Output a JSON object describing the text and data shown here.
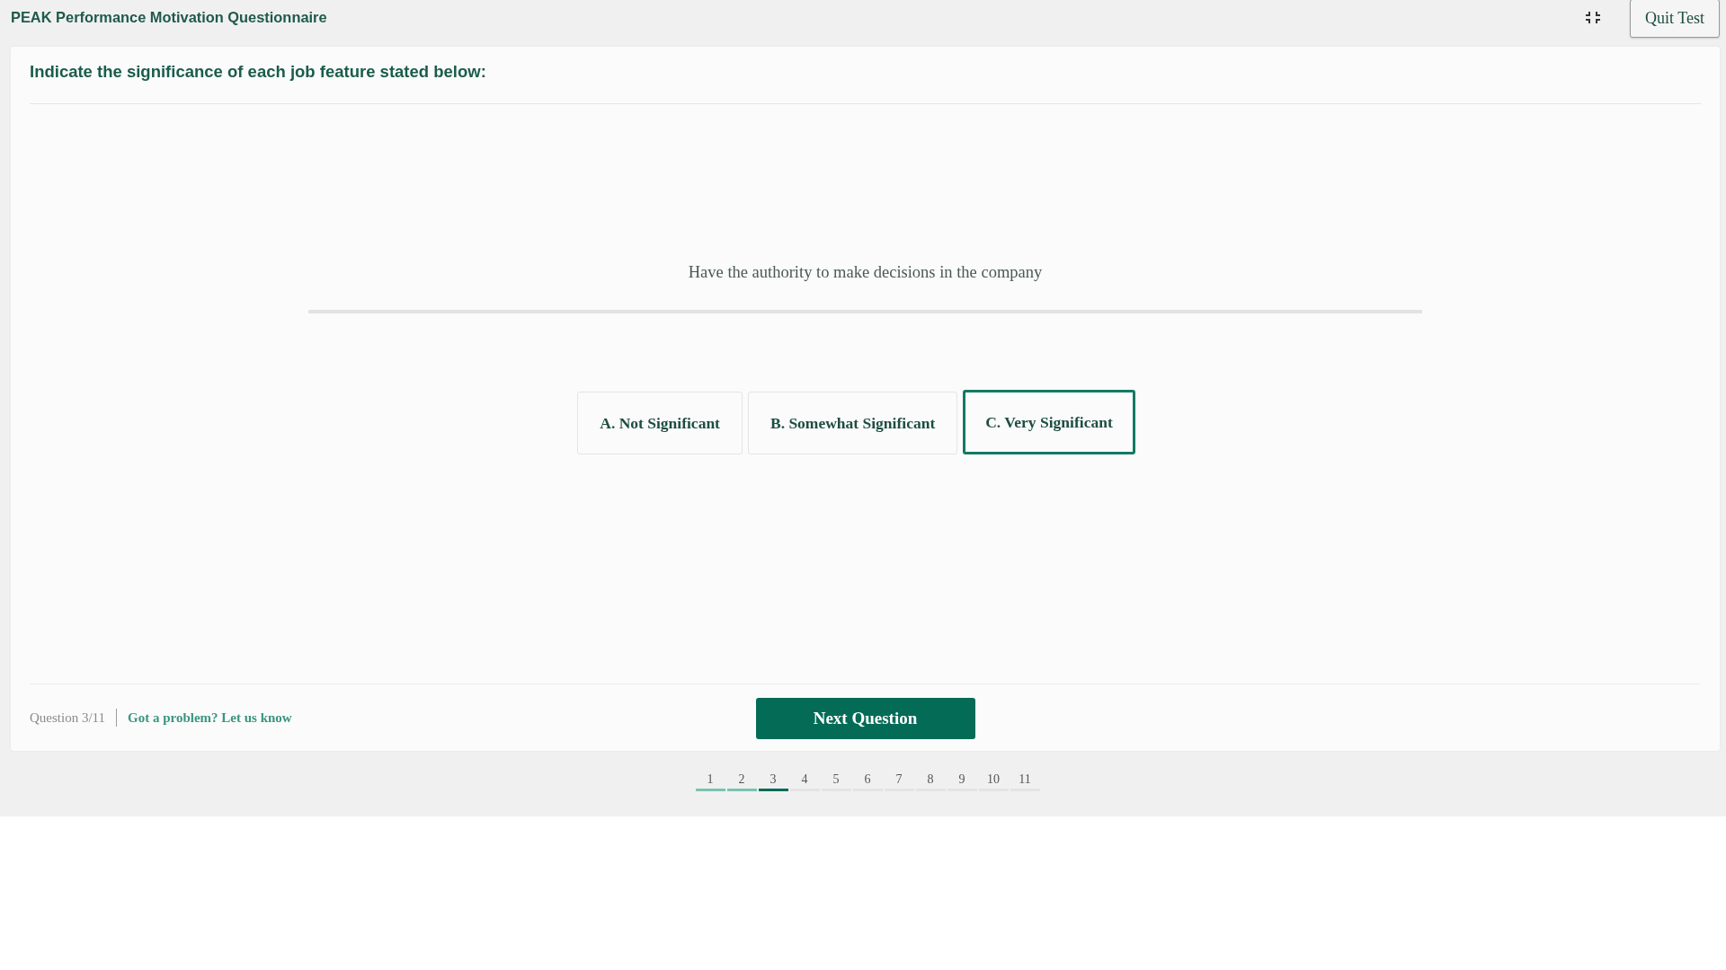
{
  "header": {
    "title": "PEAK Performance Motivation Questionnaire",
    "quit_button": "Quit Test"
  },
  "instruction": "Indicate the significance of each job feature stated below:",
  "question": "Have the authority to make decisions in the company",
  "options": [
    {
      "label": "A. Not Significant",
      "selected": false
    },
    {
      "label": "B. Somewhat Significant",
      "selected": false
    },
    {
      "label": "C. Very Significant",
      "selected": true
    }
  ],
  "footer": {
    "counter": "Question 3/11",
    "report_link": "Got a problem? Let us know",
    "next_button": "Next Question"
  },
  "pager": [
    {
      "label": "1",
      "selected": false,
      "answered": true
    },
    {
      "label": "2",
      "selected": false,
      "answered": true
    },
    {
      "label": "3",
      "selected": true,
      "answered": false
    },
    {
      "label": "4",
      "selected": false,
      "answered": false
    },
    {
      "label": "5",
      "selected": false,
      "answered": false
    },
    {
      "label": "6",
      "selected": false,
      "answered": false
    },
    {
      "label": "7",
      "selected": false,
      "answered": false
    },
    {
      "label": "8",
      "selected": false,
      "answered": false
    },
    {
      "label": "9",
      "selected": false,
      "answered": false
    },
    {
      "label": "10",
      "selected": false,
      "answered": false
    },
    {
      "label": "11",
      "selected": false,
      "answered": false
    }
  ]
}
